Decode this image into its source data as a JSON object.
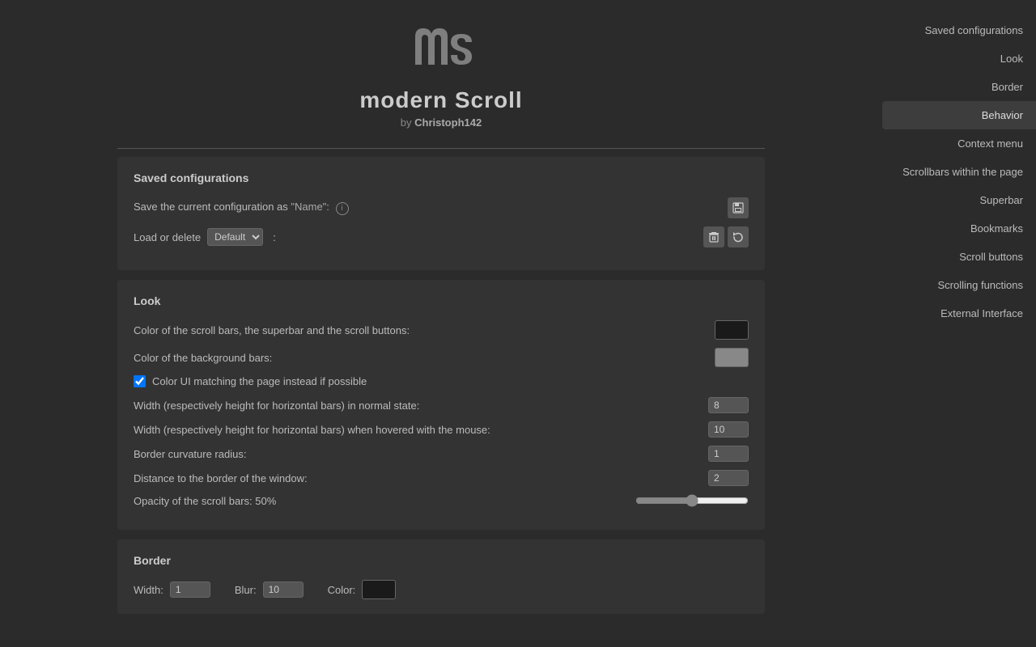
{
  "header": {
    "title": "modern Scroll",
    "title_m": "m",
    "title_rest": "odern Scroll",
    "subtitle": "by ",
    "author": "Christoph142"
  },
  "sidebar": {
    "items": [
      {
        "id": "saved-configurations",
        "label": "Saved configurations",
        "active": false
      },
      {
        "id": "look",
        "label": "Look",
        "active": false
      },
      {
        "id": "border",
        "label": "Border",
        "active": false
      },
      {
        "id": "behavior",
        "label": "Behavior",
        "active": true
      },
      {
        "id": "context-menu",
        "label": "Context menu",
        "active": false
      },
      {
        "id": "scrollbars-within-page",
        "label": "Scrollbars within the page",
        "active": false
      },
      {
        "id": "superbar",
        "label": "Superbar",
        "active": false
      },
      {
        "id": "bookmarks",
        "label": "Bookmarks",
        "active": false
      },
      {
        "id": "scroll-buttons",
        "label": "Scroll buttons",
        "active": false
      },
      {
        "id": "scrolling-functions",
        "label": "Scrolling functions",
        "active": false
      },
      {
        "id": "external-interface",
        "label": "External Interface",
        "active": false
      }
    ]
  },
  "saved_configs": {
    "section_title": "Saved configurations",
    "save_label": "Save the current configuration as ",
    "save_name_placeholder": "\"Name\":",
    "load_label": "Load or delete",
    "load_default": "Default",
    "load_options": [
      "Default"
    ]
  },
  "look": {
    "section_title": "Look",
    "scrollbar_color_label": "Color of the scroll bars, the superbar and the scroll buttons:",
    "background_color_label": "Color of the background bars:",
    "checkbox_label": "Color UI matching the page instead if possible",
    "checkbox_checked": true,
    "width_normal_label": "Width (respectively height for horizontal bars) in normal state:",
    "width_normal_value": "8",
    "width_hover_label": "Width (respectively height for horizontal bars) when hovered with the mouse:",
    "width_hover_value": "10",
    "border_radius_label": "Border curvature radius:",
    "border_radius_value": "1",
    "distance_label": "Distance to the border of the window:",
    "distance_value": "2",
    "opacity_label": "Opacity of the scroll bars: 50%",
    "opacity_value": 50
  },
  "border": {
    "section_title": "Border",
    "width_label": "Width:",
    "width_value": "1",
    "blur_label": "Blur:",
    "blur_value": "10",
    "color_label": "Color:"
  },
  "icons": {
    "save": "💾",
    "delete": "🗑",
    "reload": "↺"
  }
}
